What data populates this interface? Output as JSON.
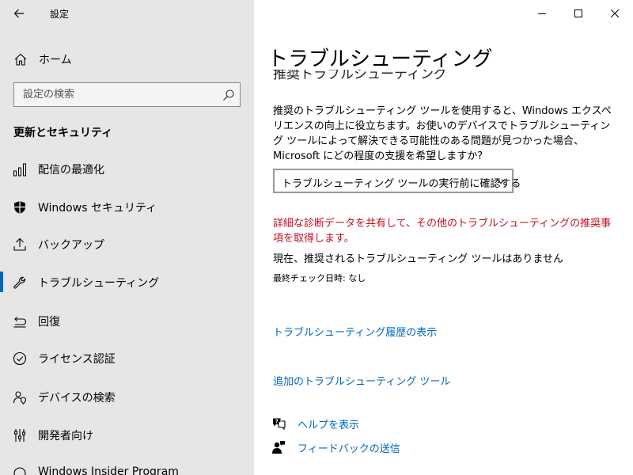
{
  "app": {
    "title": "設定"
  },
  "sidebar": {
    "home_label": "ホーム",
    "search_placeholder": "設定の検索",
    "section_title": "更新とセキュリティ",
    "items": [
      {
        "label": "配信の最適化",
        "icon": "delivery-optimization-icon"
      },
      {
        "label": "Windows セキュリティ",
        "icon": "shield-icon"
      },
      {
        "label": "バックアップ",
        "icon": "backup-icon"
      },
      {
        "label": "トラブルシューティング",
        "icon": "wrench-icon",
        "active": true
      },
      {
        "label": "回復",
        "icon": "recovery-icon"
      },
      {
        "label": "ライセンス認証",
        "icon": "checkmark-circle-icon"
      },
      {
        "label": "デバイスの検索",
        "icon": "person-location-icon"
      },
      {
        "label": "開発者向け",
        "icon": "developer-icon"
      },
      {
        "label": "Windows Insider Program",
        "icon": "insider-icon"
      }
    ]
  },
  "main": {
    "page_title": "トラブルシューティング",
    "clipped_heading": "推奨トラブルシューティング",
    "description": "推奨のトラブルシューティング ツールを使用すると、Windows エクスペリエンスの向上に役立ちます。お使いのデバイスでトラブルシューティング ツールによって解決できる可能性のある問題が見つかった場合、Microsoft にどの程度の支援を希望しますか?",
    "dropdown_value": "トラブルシューティング ツールの実行前に確認する",
    "warning_text": "詳細な診断データを共有して、その他のトラブルシューティングの推奨事項を取得します。",
    "status_text": "現在、推奨されるトラブルシューティング ツールはありません",
    "last_check": "最終チェック日時: なし",
    "history_link": "トラブルシューティング履歴の表示",
    "additional_link": "追加のトラブルシューティング ツール",
    "help_link": "ヘルプを表示",
    "feedback_link": "フィードバックの送信"
  },
  "colors": {
    "accent": "#0067c0",
    "warning": "#c50f1f",
    "sidebar_bg": "#e6e6e6"
  }
}
